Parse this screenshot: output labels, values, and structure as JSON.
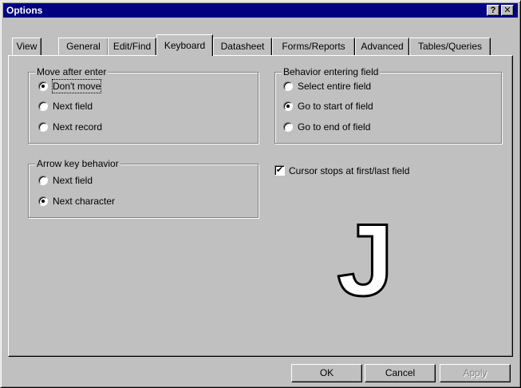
{
  "window": {
    "title": "Options",
    "help_glyph": "?",
    "close_glyph": "✕"
  },
  "tabs": [
    {
      "label": "View"
    },
    {
      "label": "General"
    },
    {
      "label": "Edit/Find"
    },
    {
      "label": "Keyboard",
      "active": true
    },
    {
      "label": "Datasheet"
    },
    {
      "label": "Forms/Reports"
    },
    {
      "label": "Advanced"
    },
    {
      "label": "Tables/Queries"
    }
  ],
  "move_after_enter": {
    "title": "Move after enter",
    "options": [
      {
        "label": "Don't move",
        "checked": true
      },
      {
        "label": "Next field",
        "checked": false
      },
      {
        "label": "Next record",
        "checked": false
      }
    ]
  },
  "behavior_entering_field": {
    "title": "Behavior entering field",
    "options": [
      {
        "label": "Select entire field",
        "checked": false
      },
      {
        "label": "Go to start of field",
        "checked": true
      },
      {
        "label": "Go to end of field",
        "checked": false
      }
    ]
  },
  "arrow_key_behavior": {
    "title": "Arrow key behavior",
    "options": [
      {
        "label": "Next field",
        "checked": false
      },
      {
        "label": "Next character",
        "checked": true
      }
    ]
  },
  "cursor_stops": {
    "label": "Cursor stops at first/last field",
    "checked": true,
    "mark": "✔"
  },
  "buttons": {
    "ok": "OK",
    "cancel": "Cancel",
    "apply": "Apply"
  },
  "overlay_letter": "J"
}
